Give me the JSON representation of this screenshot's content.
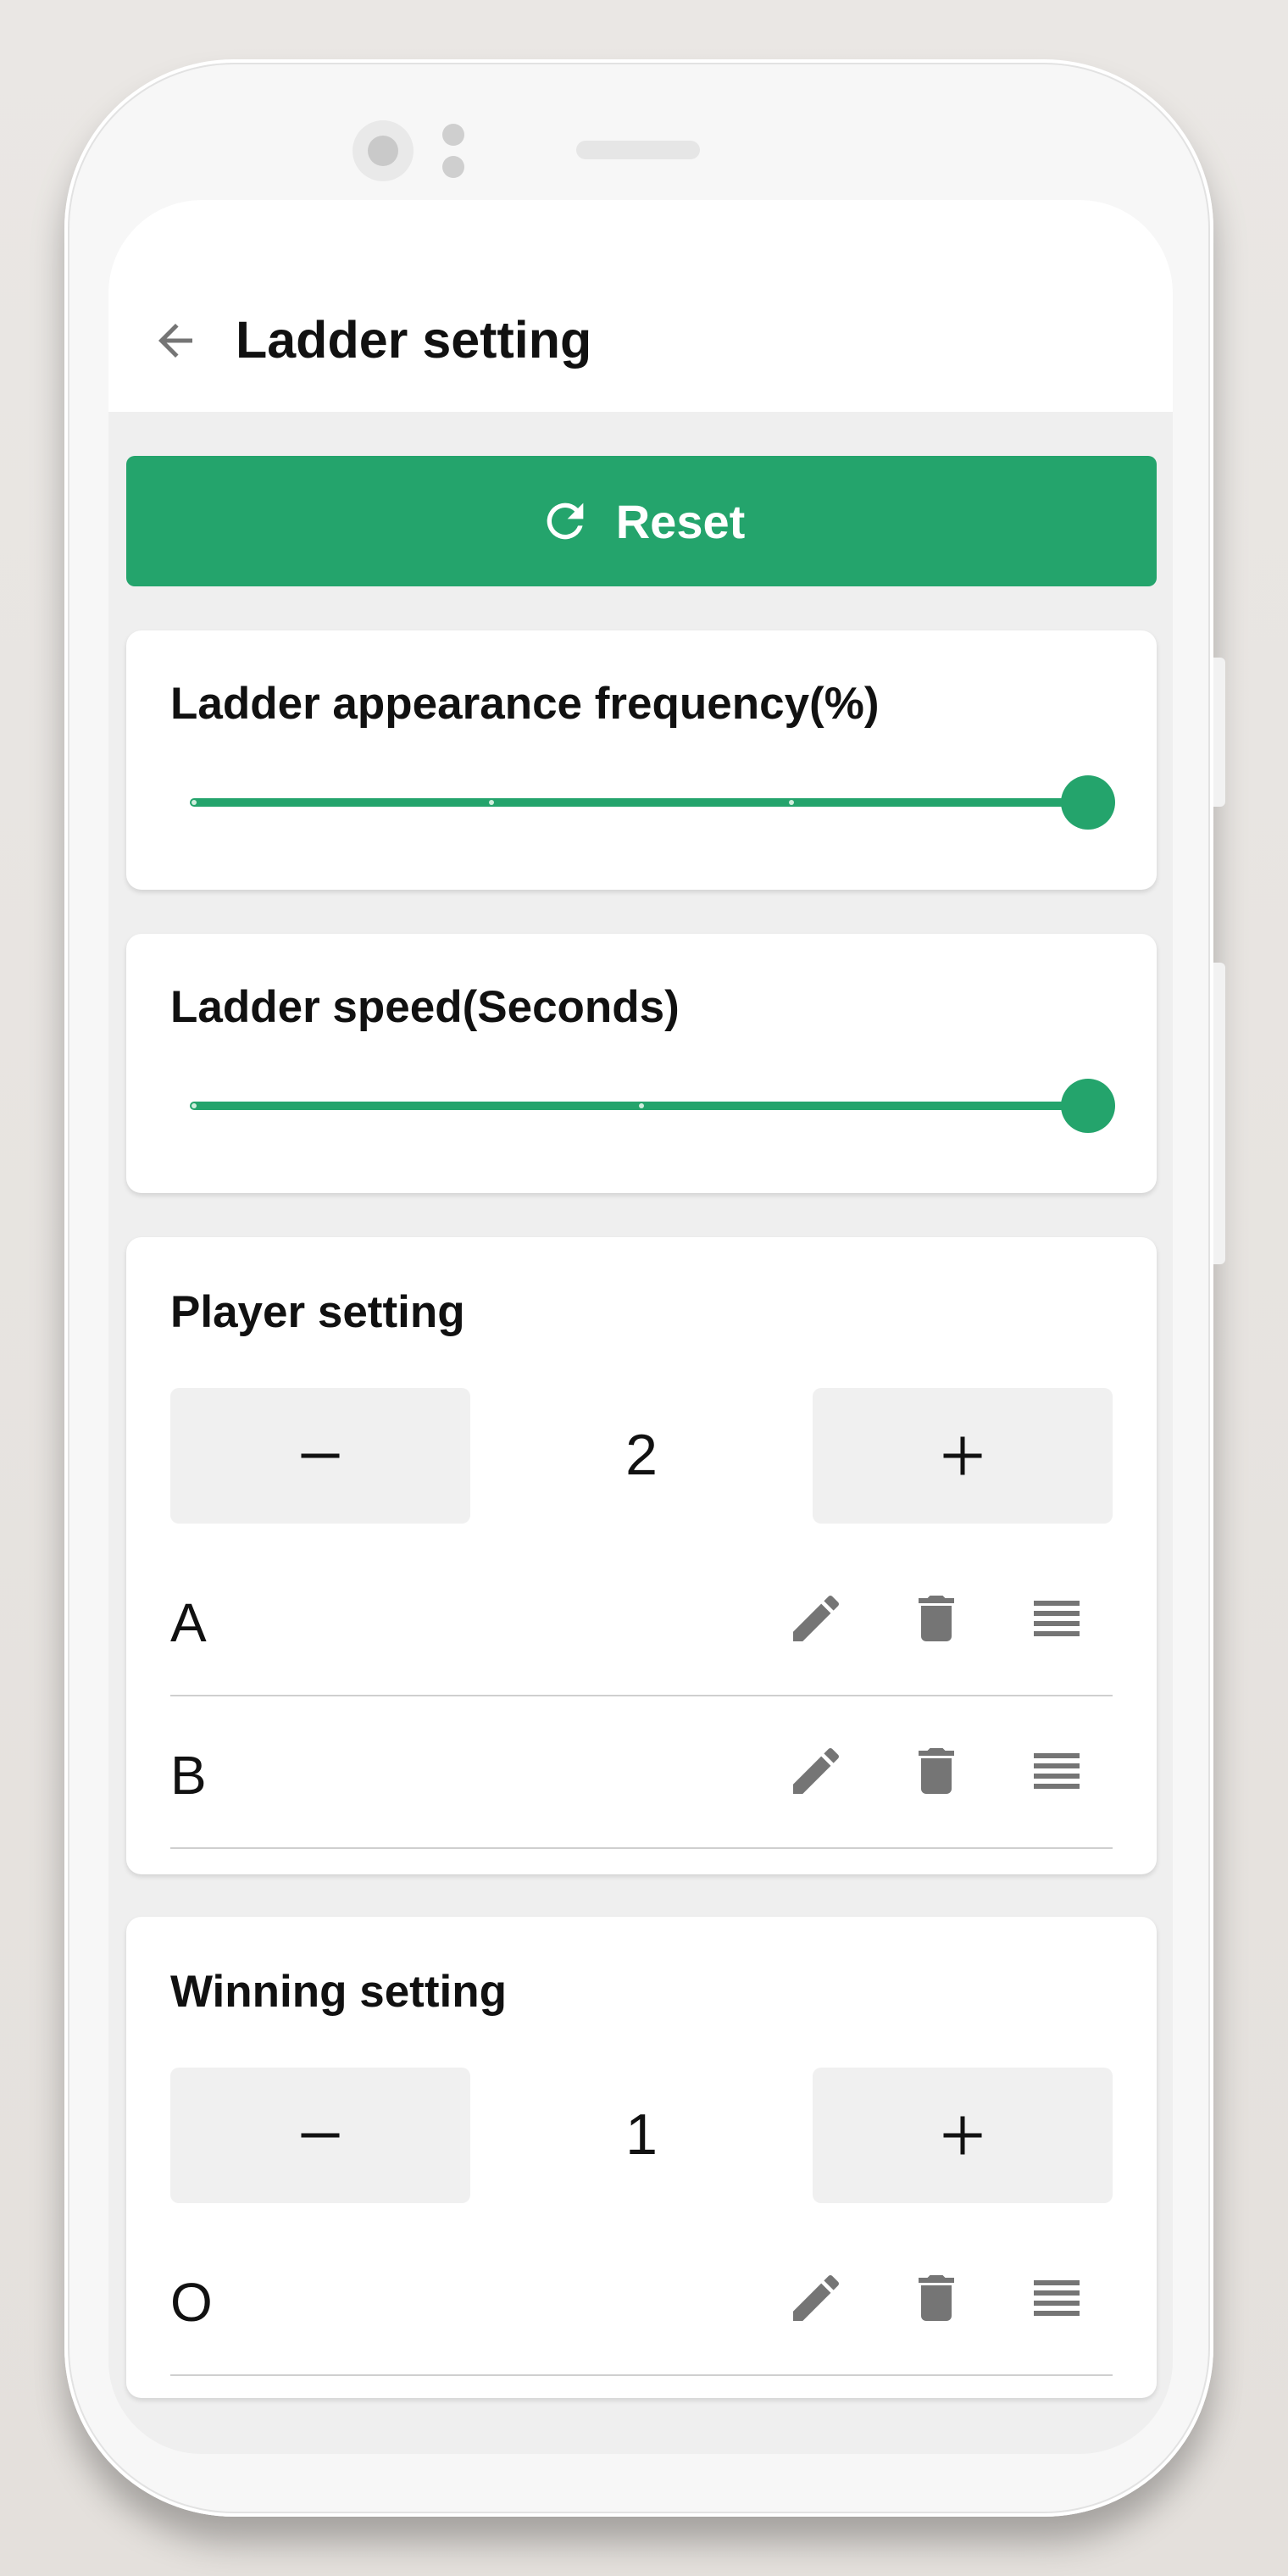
{
  "appbar": {
    "title": "Ladder setting"
  },
  "reset": {
    "label": "Reset"
  },
  "frequency": {
    "title": "Ladder appearance frequency(%)",
    "value_fraction": 1.0
  },
  "speed": {
    "title": "Ladder speed(Seconds)",
    "value_fraction": 1.0
  },
  "players": {
    "title": "Player setting",
    "minus": "–",
    "plus": "+",
    "count": "2",
    "items": [
      {
        "label": "A"
      },
      {
        "label": "B"
      }
    ]
  },
  "winning": {
    "title": "Winning setting",
    "minus": "–",
    "plus": "+",
    "count": "1",
    "items": [
      {
        "label": "O"
      }
    ]
  },
  "icons": [
    "arrow-back-icon",
    "refresh-icon",
    "edit-icon",
    "delete-icon",
    "drag-handle-icon"
  ],
  "colors": {
    "accent": "#24a46c",
    "icon_gray": "#757575",
    "background": "#efefef"
  }
}
